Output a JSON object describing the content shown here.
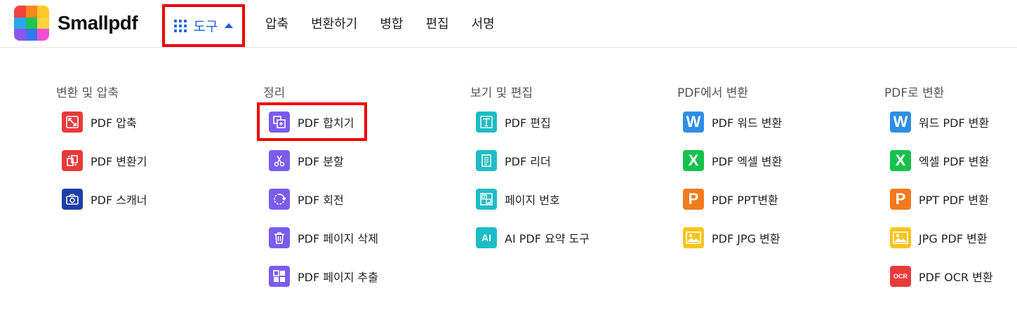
{
  "brand": {
    "name": "Smallpdf"
  },
  "colors": {
    "red_icon": "#ea3a3a",
    "purple_icon": "#7b5cf0",
    "teal_icon": "#1ebcc6",
    "navy_icon": "#1c3fa8",
    "word_blue": "#2d8ee6",
    "excel_green": "#15c14d",
    "ppt_orange": "#f37b1d",
    "jpg_yellow": "#fbc419",
    "link_blue": "#1b5fe5"
  },
  "header": {
    "tools_label": "도구",
    "nav": [
      "압축",
      "변환하기",
      "병합",
      "편집",
      "서명"
    ]
  },
  "columns": [
    {
      "title": "변환 및 압축",
      "items": [
        {
          "label": "PDF 압축",
          "icon": "compress-icon"
        },
        {
          "label": "PDF 변환기",
          "icon": "convert-icon"
        },
        {
          "label": "PDF 스캐너",
          "icon": "camera-icon"
        }
      ]
    },
    {
      "title": "정리",
      "items": [
        {
          "label": "PDF 합치기",
          "icon": "merge-icon"
        },
        {
          "label": "PDF 분할",
          "icon": "scissors-icon"
        },
        {
          "label": "PDF 회전",
          "icon": "rotate-icon"
        },
        {
          "label": "PDF 페이지 삭제",
          "icon": "trash-icon"
        },
        {
          "label": "PDF 페이지 추출",
          "icon": "extract-icon"
        }
      ]
    },
    {
      "title": "보기 및 편집",
      "items": [
        {
          "label": "PDF 편집",
          "icon": "text-edit-icon"
        },
        {
          "label": "PDF 리더",
          "icon": "document-icon"
        },
        {
          "label": "페이지 번호",
          "icon": "page-number-icon"
        },
        {
          "label": "AI PDF 요약 도구",
          "icon": "ai-icon",
          "icon_text": "AI"
        }
      ]
    },
    {
      "title": "PDF에서 변환",
      "items": [
        {
          "label": "PDF 워드 변환",
          "icon": "word-icon",
          "icon_text": "W"
        },
        {
          "label": "PDF 엑셀 변환",
          "icon": "excel-icon",
          "icon_text": "X"
        },
        {
          "label": "PDF PPT변환",
          "icon": "ppt-icon",
          "icon_text": "P"
        },
        {
          "label": "PDF JPG 변환",
          "icon": "image-icon"
        }
      ]
    },
    {
      "title": "PDF로 변환",
      "items": [
        {
          "label": "워드 PDF 변환",
          "icon": "word-icon",
          "icon_text": "W"
        },
        {
          "label": "엑셀 PDF 변환",
          "icon": "excel-icon",
          "icon_text": "X"
        },
        {
          "label": "PPT PDF 변환",
          "icon": "ppt-icon",
          "icon_text": "P"
        },
        {
          "label": "JPG PDF 변환",
          "icon": "image-icon"
        },
        {
          "label": "PDF OCR 변환",
          "icon": "ocr-icon",
          "icon_text": "OCR"
        }
      ]
    }
  ]
}
